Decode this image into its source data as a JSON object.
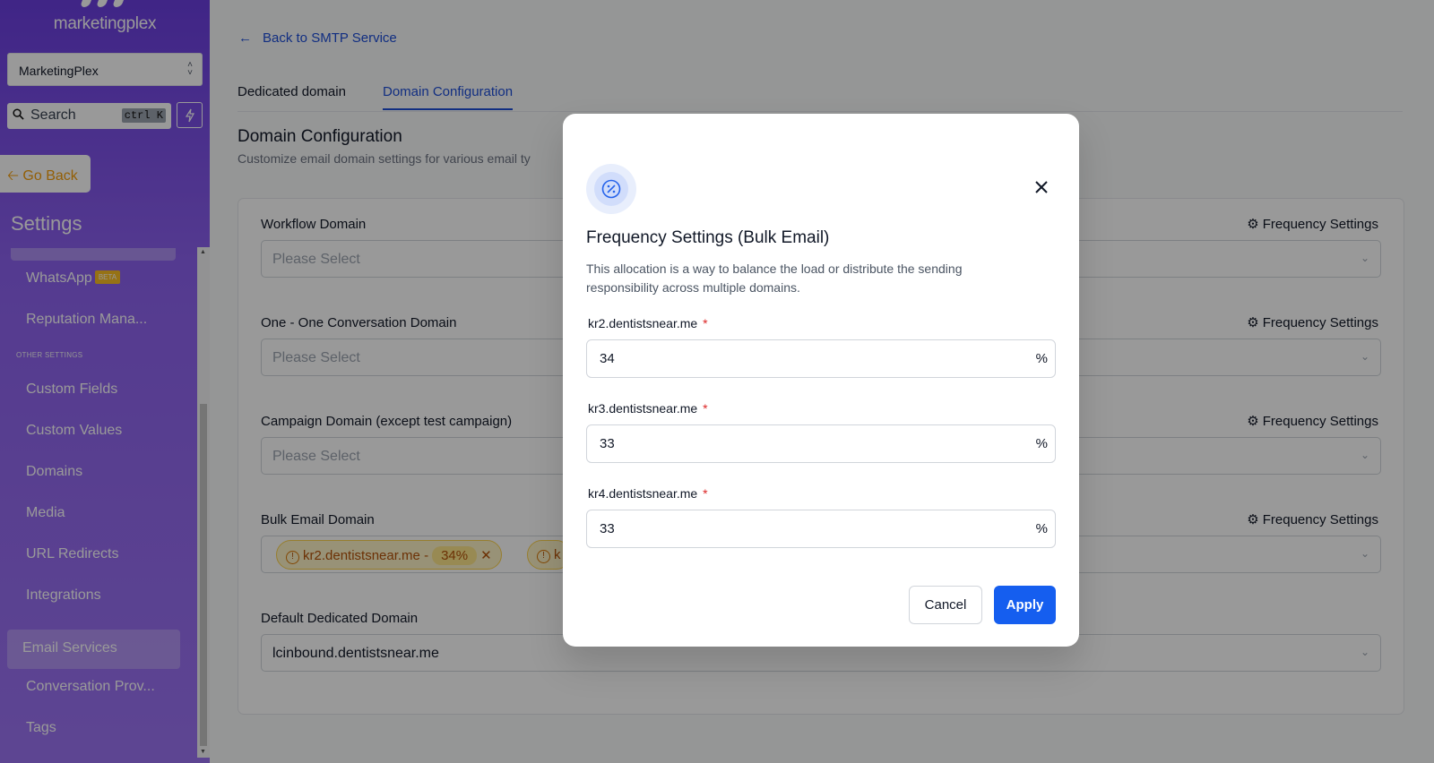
{
  "app": {
    "logo_text": "marketingplex",
    "account_select": "MarketingPlex",
    "search_placeholder": "Search",
    "search_shortcut": "ctrl K",
    "go_back_label": "Go Back",
    "settings_title": "Settings",
    "colors": {
      "sidebar_top": "#6b3ee0",
      "sidebar_bottom": "#9c74f3",
      "accent": "#155eef",
      "tag_bg": "#fef3c7"
    }
  },
  "sidebar": {
    "items": [
      {
        "label": "WhatsApp",
        "badge": "BETA"
      },
      {
        "label": "Reputation Mana..."
      }
    ],
    "section_label": "OTHER SETTINGS",
    "other_items": [
      {
        "label": "Custom Fields"
      },
      {
        "label": "Custom Values"
      },
      {
        "label": "Domains"
      },
      {
        "label": "Media"
      },
      {
        "label": "URL Redirects"
      },
      {
        "label": "Integrations"
      },
      {
        "label": "Email Services",
        "active": true
      },
      {
        "label": "Conversation Prov..."
      },
      {
        "label": "Tags"
      }
    ]
  },
  "main": {
    "back_link": "Back to SMTP Service",
    "tabs": [
      {
        "label": "Dedicated domain"
      },
      {
        "label": "Domain Configuration",
        "active": true
      }
    ],
    "title": "Domain Configuration",
    "subtitle": "Customize email domain settings for various email ty",
    "frequency_label": "Frequency Settings",
    "fields": [
      {
        "label": "Workflow Domain",
        "placeholder": "Please Select"
      },
      {
        "label": "One - One Conversation Domain",
        "placeholder": "Please Select"
      },
      {
        "label": "Campaign Domain (except test campaign)",
        "placeholder": "Please Select"
      },
      {
        "label": "Bulk Email Domain",
        "tags": [
          {
            "domain": "kr2.dentistsnear.me -",
            "percent": "34%"
          },
          {
            "domain": "k"
          }
        ]
      },
      {
        "label": "Default Dedicated Domain",
        "value": "lcinbound.dentistsnear.me"
      }
    ]
  },
  "modal": {
    "title": "Frequency Settings (Bulk Email)",
    "description": "This allocation is a way to balance the load or distribute the sending responsibility across multiple domains.",
    "required_mark": "*",
    "suffix": "%",
    "domains": [
      {
        "label": "kr2.dentistsnear.me",
        "value": "34"
      },
      {
        "label": "kr3.dentistsnear.me",
        "value": "33"
      },
      {
        "label": "kr4.dentistsnear.me",
        "value": "33"
      }
    ],
    "cancel_label": "Cancel",
    "apply_label": "Apply"
  }
}
